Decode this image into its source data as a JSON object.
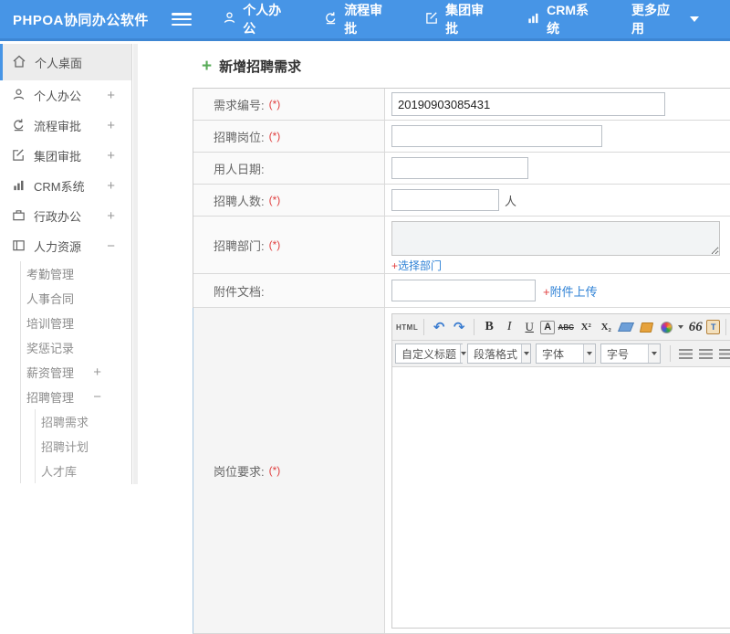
{
  "header": {
    "app_title": "PHPOA协同办公软件",
    "nav": [
      {
        "label": "个人办公",
        "icon": "user-icon"
      },
      {
        "label": "流程审批",
        "icon": "workflow-icon"
      },
      {
        "label": "集团审批",
        "icon": "edit-icon"
      },
      {
        "label": "CRM系统",
        "icon": "chart-icon"
      },
      {
        "label": "更多应用",
        "icon": "caret-down-icon"
      }
    ]
  },
  "sidebar": {
    "items": [
      {
        "label": "个人桌面",
        "icon": "home-icon",
        "active": true
      },
      {
        "label": "个人办公",
        "icon": "user-icon",
        "expand": "+"
      },
      {
        "label": "流程审批",
        "icon": "workflow-icon",
        "expand": "+"
      },
      {
        "label": "集团审批",
        "icon": "edit-icon",
        "expand": "+"
      },
      {
        "label": "CRM系统",
        "icon": "chart-icon",
        "expand": "+"
      },
      {
        "label": "行政办公",
        "icon": "briefcase-icon",
        "expand": "+"
      },
      {
        "label": "人力资源",
        "icon": "idcard-icon",
        "expand": "−"
      }
    ],
    "hr_children": [
      {
        "label": "考勤管理"
      },
      {
        "label": "人事合同"
      },
      {
        "label": "培训管理"
      },
      {
        "label": "奖惩记录"
      },
      {
        "label": "薪资管理",
        "expand": "+"
      },
      {
        "label": "招聘管理",
        "expand": "−"
      }
    ],
    "recruit_children": [
      {
        "label": "招聘需求"
      },
      {
        "label": "招聘计划"
      },
      {
        "label": "人才库"
      }
    ]
  },
  "main": {
    "page_title": "新增招聘需求",
    "add_icon": "+",
    "form": {
      "required_mark": "(*)",
      "rows": [
        {
          "label": "需求编号:",
          "required": true,
          "value": "20190903085431"
        },
        {
          "label": "招聘岗位:",
          "required": true,
          "value": ""
        },
        {
          "label": "用人日期:",
          "required": false,
          "value": ""
        },
        {
          "label": "招聘人数:",
          "required": true,
          "value": "",
          "suffix": "人"
        },
        {
          "label": "招聘部门:",
          "required": true,
          "link_plus": "+",
          "link_text": "选择部门"
        },
        {
          "label": "附件文档:",
          "required": false,
          "value": "",
          "link_plus": "+",
          "link_text": "附件上传"
        },
        {
          "label": "岗位要求:",
          "required": true
        }
      ]
    },
    "editor": {
      "toolbar": {
        "html_label": "HTML",
        "undo": "↶",
        "redo": "↷",
        "bold": "B",
        "italic": "I",
        "underline": "U",
        "font_border": "A",
        "strike": "ABC",
        "superscript": "X²",
        "subscript": "X₂",
        "quote": "66",
        "paste_text": "T",
        "font_color": "A"
      },
      "dropdowns": [
        {
          "label": "自定义标题"
        },
        {
          "label": "段落格式"
        },
        {
          "label": "字体"
        },
        {
          "label": "字号"
        }
      ]
    }
  },
  "colors": {
    "header_bg": "#4795e6",
    "header_border": "#3d86d3",
    "active_accent": "#4795e6",
    "link_blue": "#2f82d6",
    "required_red": "#e03e3e",
    "title_plus_green": "#57ab57"
  }
}
